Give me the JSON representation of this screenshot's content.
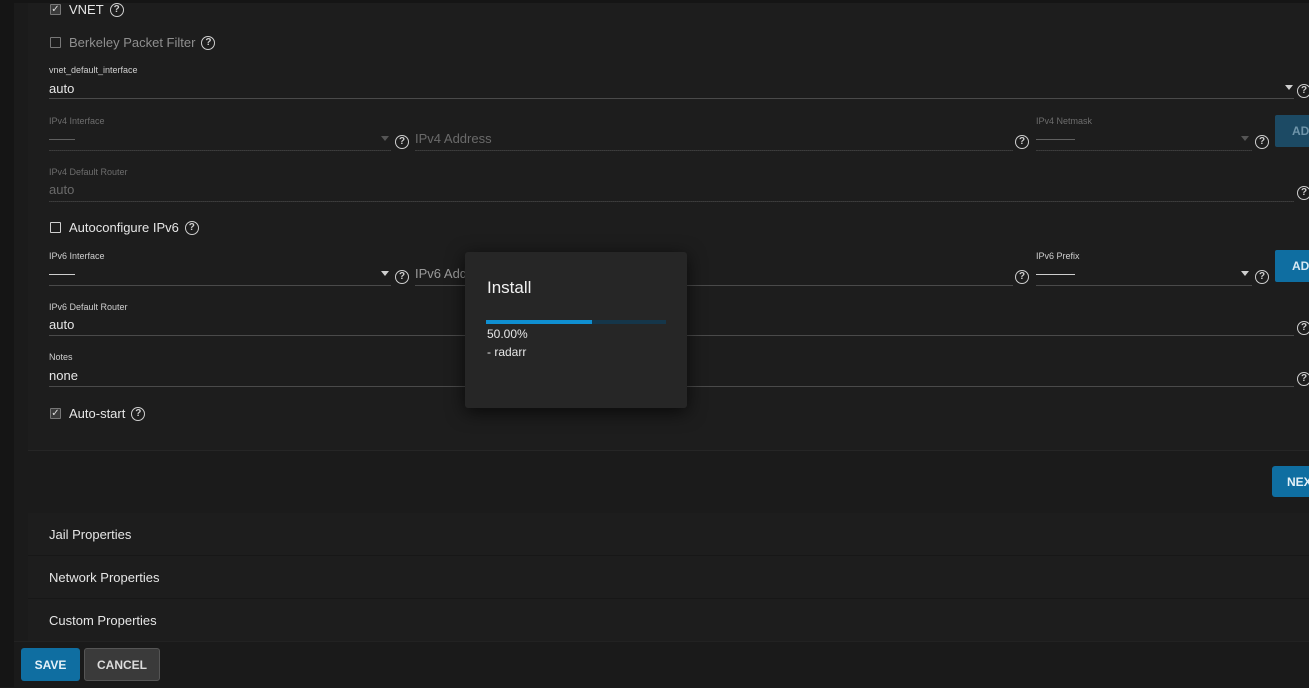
{
  "form": {
    "vnet": {
      "label": "VNET",
      "checked": true
    },
    "bpf": {
      "label": "Berkeley Packet Filter",
      "checked": false
    },
    "vnet_default_interface": {
      "label": "vnet_default_interface",
      "value": "auto"
    },
    "ipv4_interface": {
      "label": "IPv4 Interface",
      "value": "——"
    },
    "ipv4_address": {
      "placeholder": "IPv4 Address"
    },
    "ipv4_netmask": {
      "label": "IPv4 Netmask",
      "value": "———"
    },
    "ipv4_add_button": "AD",
    "ipv4_default_router": {
      "label": "IPv4 Default Router",
      "value": "auto"
    },
    "autoconfigure_ipv6": {
      "label": "Autoconfigure IPv6",
      "checked": false
    },
    "ipv6_interface": {
      "label": "IPv6 Interface",
      "value": "——"
    },
    "ipv6_address": {
      "placeholder": "IPv6 Add"
    },
    "ipv6_prefix": {
      "label": "IPv6 Prefix",
      "value": "———"
    },
    "ipv6_add_button": "AD",
    "ipv6_default_router": {
      "label": "IPv6 Default Router",
      "value": "auto"
    },
    "notes": {
      "label": "Notes",
      "value": "none"
    },
    "autostart": {
      "label": "Auto-start",
      "checked": true
    },
    "next_button": "NEX"
  },
  "accordion": [
    {
      "label": "Jail Properties"
    },
    {
      "label": "Network Properties"
    },
    {
      "label": "Custom Properties"
    }
  ],
  "footer": {
    "save_label": "SAVE",
    "cancel_label": "CANCEL"
  },
  "dialog": {
    "title": "Install",
    "progress_percent": 50,
    "progress_text": "50.00%",
    "item": "- radarr"
  },
  "icons": {
    "help": "help-circle-icon",
    "dropdown": "caret-down-icon",
    "check": "check-icon"
  },
  "colors": {
    "accent": "#0f6ea1",
    "progress": "#0f8fd1",
    "background": "#1b1b1b",
    "dialog": "#262626"
  }
}
